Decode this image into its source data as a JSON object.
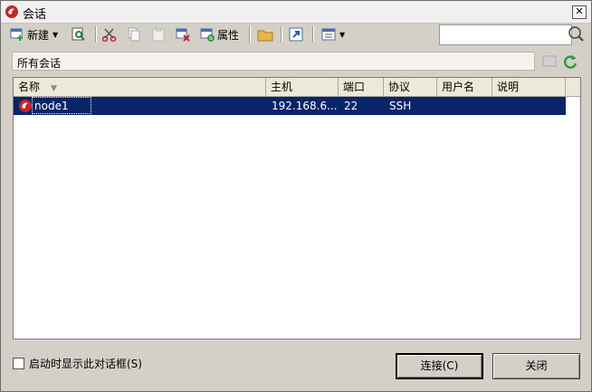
{
  "window": {
    "title": "会话"
  },
  "toolbar": {
    "new_label": "新建",
    "properties_label": "属性"
  },
  "search": {
    "value": ""
  },
  "path": {
    "text": "所有会话"
  },
  "table": {
    "columns": [
      "名称",
      "主机",
      "端口",
      "协议",
      "用户名",
      "说明"
    ],
    "rows": [
      {
        "name": "node1",
        "host": "192.168.6...",
        "port": "22",
        "protocol": "SSH",
        "user": "",
        "desc": ""
      }
    ]
  },
  "footer": {
    "startup_checkbox_label": "启动时显示此对话框(S)",
    "startup_checked": false,
    "connect_label": "连接(C)",
    "close_label": "关闭"
  },
  "colors": {
    "selection": "#0a246a",
    "accent_red": "#c0262c",
    "refresh_green": "#2e9e3a"
  }
}
